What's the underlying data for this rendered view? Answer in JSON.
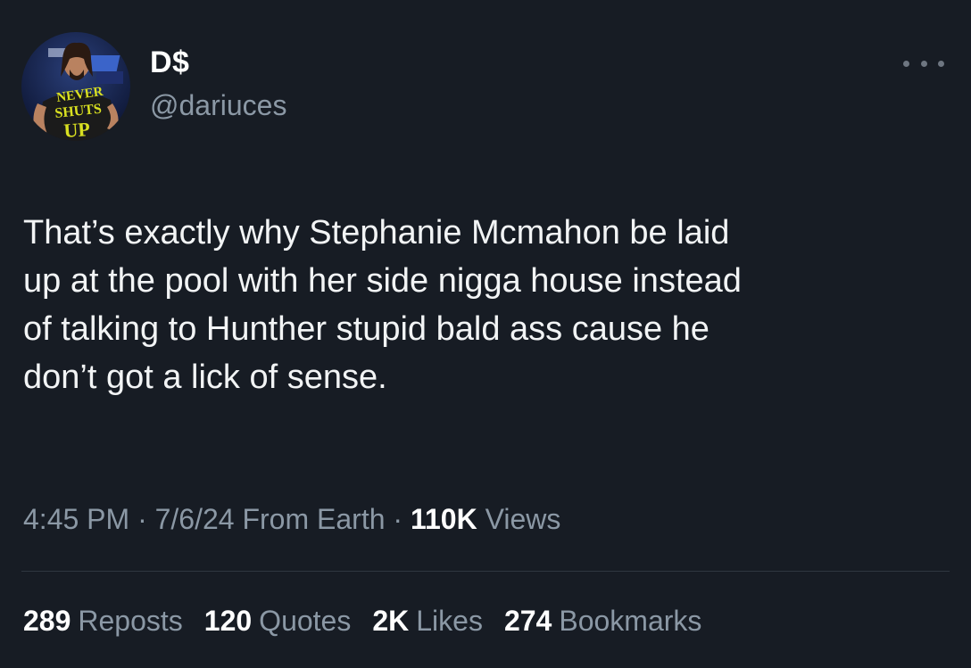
{
  "user": {
    "display_name": "D$",
    "handle": "@dariuces",
    "avatar_shirt_text": [
      "NEVER",
      "SHUTS",
      "UP"
    ]
  },
  "tweet": {
    "text": "That’s exactly why Stephanie Mcmahon be laid\nup at the pool with her side nigga house instead\nof talking to Hunther stupid bald ass cause he\ndon’t got a lick of sense."
  },
  "meta": {
    "time": "4:45 PM",
    "sep1": " · ",
    "date": "7/6/24",
    "source": " From Earth",
    "sep2": " · ",
    "views_count": "110K",
    "views_label": " Views"
  },
  "stats": [
    {
      "count": "289",
      "label": "Reposts"
    },
    {
      "count": "120",
      "label": "Quotes"
    },
    {
      "count": "2K",
      "label": "Likes"
    },
    {
      "count": "274",
      "label": "Bookmarks"
    }
  ],
  "colors": {
    "background": "#171c24",
    "primary_text": "#e7e9ea",
    "secondary_text": "#8b98a5",
    "avatar_shirt": "#d9e021"
  },
  "icons": {
    "more": "more-horizontal-icon"
  }
}
